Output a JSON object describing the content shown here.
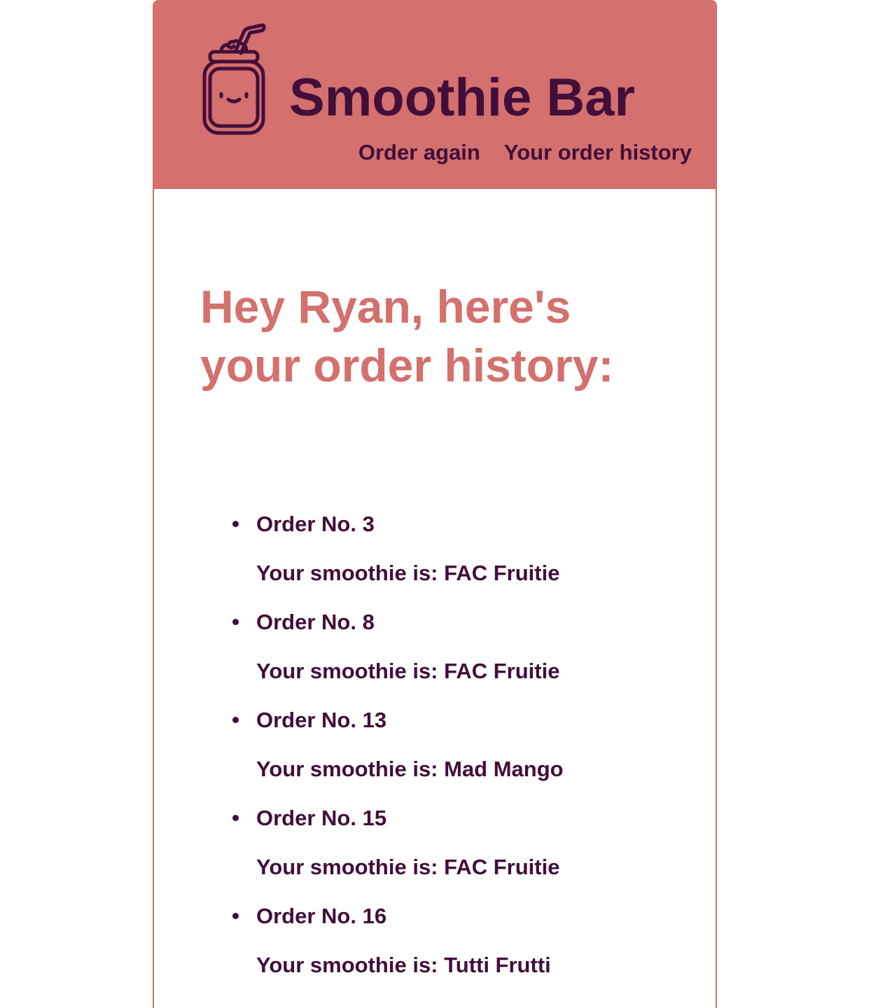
{
  "header": {
    "logo_icon": "smoothie-jar-icon",
    "brand_title": "Smoothie Bar",
    "nav": [
      {
        "label": "Order again"
      },
      {
        "label": "Your order history"
      }
    ]
  },
  "main": {
    "greeting": "Hey Ryan, here's your order history:",
    "orders": [
      {
        "order_label": "Order No. 3",
        "smoothie_text": "Your smoothie is: FAC Fruitie"
      },
      {
        "order_label": "Order No. 8",
        "smoothie_text": "Your smoothie is: FAC Fruitie"
      },
      {
        "order_label": "Order No. 13",
        "smoothie_text": "Your smoothie is: Mad Mango"
      },
      {
        "order_label": "Order No. 15",
        "smoothie_text": "Your smoothie is: FAC Fruitie"
      },
      {
        "order_label": "Order No. 16",
        "smoothie_text": "Your smoothie is: Tutti Frutti"
      }
    ]
  },
  "colors": {
    "header_bg": "#d4706d",
    "text_dark": "#420e3a",
    "accent": "#d4706d",
    "page_bg": "#ffffff"
  }
}
